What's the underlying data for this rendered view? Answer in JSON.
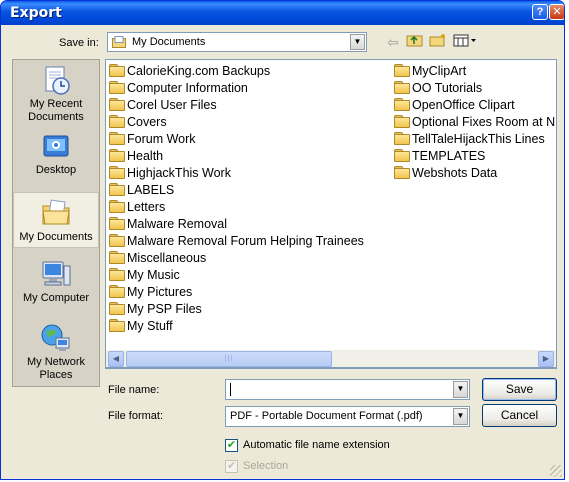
{
  "window": {
    "title": "Export"
  },
  "save_in": {
    "label": "Save in:",
    "value": "My Documents"
  },
  "places": [
    {
      "name": "place-my-recent-documents",
      "label": "My Recent\nDocuments",
      "icon": "recent-documents-icon"
    },
    {
      "name": "place-desktop",
      "label": "Desktop",
      "icon": "desktop-icon"
    },
    {
      "name": "place-my-documents",
      "label": "My Documents",
      "icon": "my-documents-icon",
      "selected": true
    },
    {
      "name": "place-my-computer",
      "label": "My Computer",
      "icon": "my-computer-icon"
    },
    {
      "name": "place-my-network-places",
      "label": "My Network\nPlaces",
      "icon": "network-places-icon"
    }
  ],
  "files": {
    "column1": [
      "CalorieKing.com Backups",
      "Computer Information",
      "Corel User Files",
      "Covers",
      "Forum Work",
      "Health",
      "HighjackThis Work",
      "LABELS",
      "Letters",
      "Malware Removal",
      "Malware Removal Forum Helping Trainees",
      "Miscellaneous",
      "My Music",
      "My Pictures",
      "My PSP Files",
      "My Stuff"
    ],
    "column2": [
      "MyClipArt",
      "OO Tutorials",
      "OpenOffice Clipart",
      "Optional Fixes Room at N",
      "TellTaleHijackThis Lines",
      "TEMPLATES",
      "Webshots Data"
    ]
  },
  "file_name": {
    "label": "File name:",
    "value": ""
  },
  "file_format": {
    "label": "File format:",
    "value": "PDF - Portable Document Format (.pdf)"
  },
  "buttons": {
    "save": "Save",
    "cancel": "Cancel"
  },
  "options": {
    "auto_ext": {
      "label": "Automatic file name extension",
      "checked": true
    },
    "selection": {
      "label": "Selection",
      "checked": true,
      "disabled": true
    }
  },
  "colors": {
    "titlebar": "#0a53e0",
    "dialog_bg": "#ece9d8",
    "selection_scroll": "#b7cdf5"
  }
}
